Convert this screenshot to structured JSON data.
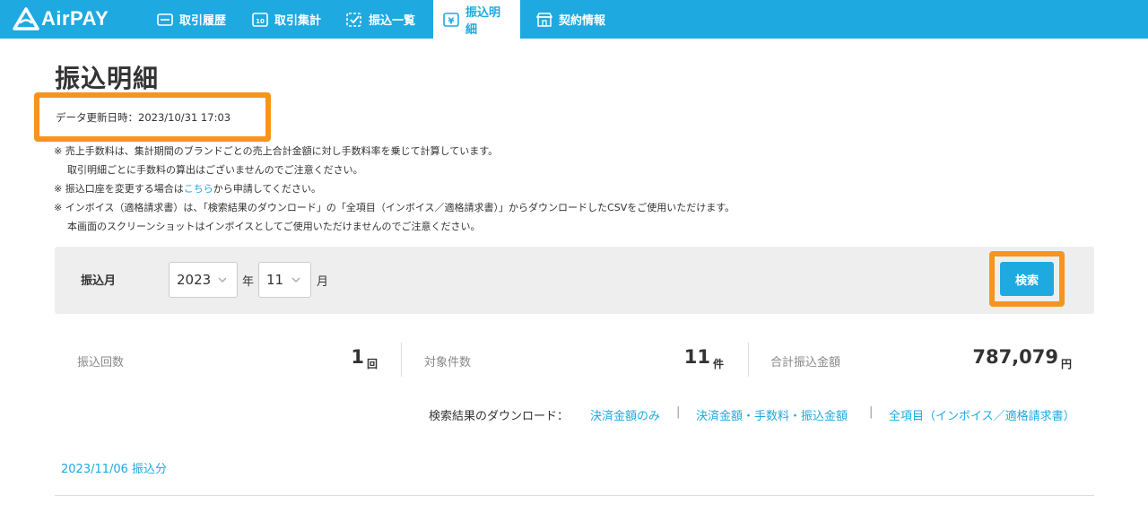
{
  "brand": {
    "name": "AirPAY"
  },
  "nav": {
    "items": [
      {
        "label": "取引履歴",
        "icon": "card-icon"
      },
      {
        "label": "取引集計",
        "icon": "calendar-icon"
      },
      {
        "label": "振込一覧",
        "icon": "checklist-icon"
      },
      {
        "label": "振込明細",
        "icon": "yen-doc-icon",
        "active": true
      },
      {
        "label": "契約情報",
        "icon": "shop-icon"
      }
    ]
  },
  "page": {
    "title": "振込明細",
    "updated_at": "データ更新日時：2023/10/31 17:03"
  },
  "notes": {
    "line1": "※ 売上手数料は、集計期間のブランドごとの売上合計金額に対し手数料率を乗じて計算しています。",
    "line2": "取引明細ごとに手数料の算出はございませんのでご注意ください。",
    "line3_before": "※ 振込口座を変更する場合は",
    "line3_link": "こちら",
    "line3_after": "から申請してください。",
    "line4": "※ インボイス（適格請求書）は、「検索結果のダウンロード」の「全項目（インボイス／適格請求書）」からダウンロードしたCSVをご使用いただけます。",
    "line5": "本画面のスクリーンショットはインボイスとしてご使用いただけませんのでご注意ください。"
  },
  "search": {
    "label": "振込月",
    "year_value": "2023",
    "year_unit": "年",
    "month_value": "11",
    "month_unit": "月",
    "button": "検索"
  },
  "summary": {
    "count_label": "振込回数",
    "count_value": "1",
    "count_unit": "回",
    "items_label": "対象件数",
    "items_value": "11",
    "items_unit": "件",
    "total_label": "合計振込金額",
    "total_value": "787,079",
    "total_unit": "円"
  },
  "downloads": {
    "label": "検索結果のダウンロード：",
    "link1": "決済金額のみ",
    "link2": "決済金額・手数料・振込金額",
    "link3": "全項目（インボイス／適格請求書）",
    "separator": "|"
  },
  "transfer": {
    "date_label": "2023/11/06 振込分"
  },
  "colors": {
    "brand": "#1fa9e1",
    "highlight": "#f7941d",
    "panel": "#eeeeee"
  }
}
